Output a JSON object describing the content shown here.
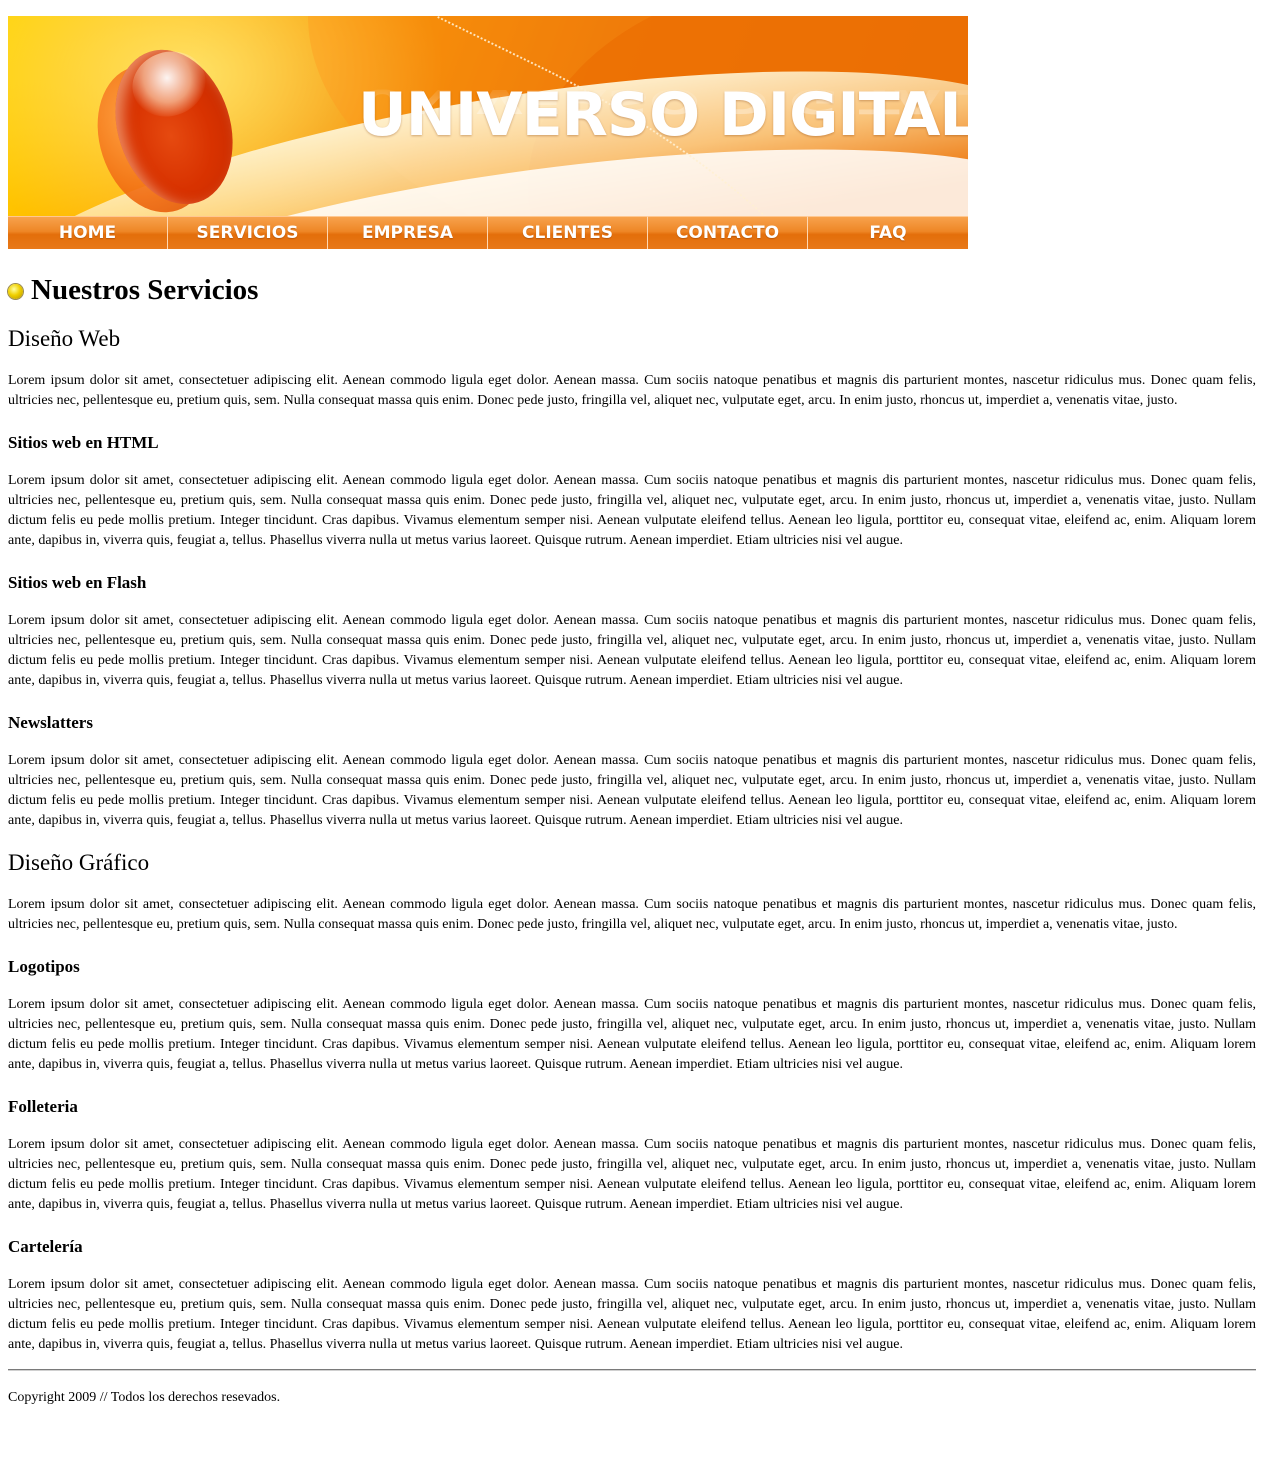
{
  "colors": {
    "accent": "#e8791a",
    "banner_orange": "#e06400",
    "banner_yellow": "#ffd000"
  },
  "banner": {
    "title": "UNIVERSO DIGITAL"
  },
  "nav": {
    "items": [
      "HOME",
      "SERVICIOS",
      "EMPRESA",
      "CLIENTES",
      "CONTACTO",
      "FAQ"
    ]
  },
  "page_title": "Nuestros Servicios",
  "sections": [
    {
      "heading": "Diseño Web",
      "intro": "Lorem ipsum dolor sit amet, consectetuer adipiscing elit. Aenean commodo ligula eget dolor. Aenean massa. Cum sociis natoque penatibus et magnis dis parturient montes, nascetur ridiculus mus. Donec quam felis, ultricies nec, pellentesque eu, pretium quis, sem. Nulla consequat massa quis enim. Donec pede justo, fringilla vel, aliquet nec, vulputate eget, arcu. In enim justo, rhoncus ut, imperdiet a, venenatis vitae, justo.",
      "subsections": [
        {
          "heading": "Sitios web en HTML",
          "text": "Lorem ipsum dolor sit amet, consectetuer adipiscing elit. Aenean commodo ligula eget dolor. Aenean massa. Cum sociis natoque penatibus et magnis dis parturient montes, nascetur ridiculus mus. Donec quam felis, ultricies nec, pellentesque eu, pretium quis, sem. Nulla consequat massa quis enim. Donec pede justo, fringilla vel, aliquet nec, vulputate eget, arcu. In enim justo, rhoncus ut, imperdiet a, venenatis vitae, justo. Nullam dictum felis eu pede mollis pretium. Integer tincidunt. Cras dapibus. Vivamus elementum semper nisi. Aenean vulputate eleifend tellus. Aenean leo ligula, porttitor eu, consequat vitae, eleifend ac, enim. Aliquam lorem ante, dapibus in, viverra quis, feugiat a, tellus. Phasellus viverra nulla ut metus varius laoreet. Quisque rutrum. Aenean imperdiet. Etiam ultricies nisi vel augue."
        },
        {
          "heading": "Sitios web en Flash",
          "text": "Lorem ipsum dolor sit amet, consectetuer adipiscing elit. Aenean commodo ligula eget dolor. Aenean massa. Cum sociis natoque penatibus et magnis dis parturient montes, nascetur ridiculus mus. Donec quam felis, ultricies nec, pellentesque eu, pretium quis, sem. Nulla consequat massa quis enim. Donec pede justo, fringilla vel, aliquet nec, vulputate eget, arcu. In enim justo, rhoncus ut, imperdiet a, venenatis vitae, justo. Nullam dictum felis eu pede mollis pretium. Integer tincidunt. Cras dapibus. Vivamus elementum semper nisi. Aenean vulputate eleifend tellus. Aenean leo ligula, porttitor eu, consequat vitae, eleifend ac, enim. Aliquam lorem ante, dapibus in, viverra quis, feugiat a, tellus. Phasellus viverra nulla ut metus varius laoreet. Quisque rutrum. Aenean imperdiet. Etiam ultricies nisi vel augue."
        },
        {
          "heading": "Newslatters",
          "text": "Lorem ipsum dolor sit amet, consectetuer adipiscing elit. Aenean commodo ligula eget dolor. Aenean massa. Cum sociis natoque penatibus et magnis dis parturient montes, nascetur ridiculus mus. Donec quam felis, ultricies nec, pellentesque eu, pretium quis, sem. Nulla consequat massa quis enim. Donec pede justo, fringilla vel, aliquet nec, vulputate eget, arcu. In enim justo, rhoncus ut, imperdiet a, venenatis vitae, justo. Nullam dictum felis eu pede mollis pretium. Integer tincidunt. Cras dapibus. Vivamus elementum semper nisi. Aenean vulputate eleifend tellus. Aenean leo ligula, porttitor eu, consequat vitae, eleifend ac, enim. Aliquam lorem ante, dapibus in, viverra quis, feugiat a, tellus. Phasellus viverra nulla ut metus varius laoreet. Quisque rutrum. Aenean imperdiet. Etiam ultricies nisi vel augue."
        }
      ]
    },
    {
      "heading": "Diseño Gráfico",
      "intro": "Lorem ipsum dolor sit amet, consectetuer adipiscing elit. Aenean commodo ligula eget dolor. Aenean massa. Cum sociis natoque penatibus et magnis dis parturient montes, nascetur ridiculus mus. Donec quam felis, ultricies nec, pellentesque eu, pretium quis, sem. Nulla consequat massa quis enim. Donec pede justo, fringilla vel, aliquet nec, vulputate eget, arcu. In enim justo, rhoncus ut, imperdiet a, venenatis vitae, justo.",
      "subsections": [
        {
          "heading": "Logotipos",
          "text": "Lorem ipsum dolor sit amet, consectetuer adipiscing elit. Aenean commodo ligula eget dolor. Aenean massa. Cum sociis natoque penatibus et magnis dis parturient montes, nascetur ridiculus mus. Donec quam felis, ultricies nec, pellentesque eu, pretium quis, sem. Nulla consequat massa quis enim. Donec pede justo, fringilla vel, aliquet nec, vulputate eget, arcu. In enim justo, rhoncus ut, imperdiet a, venenatis vitae, justo. Nullam dictum felis eu pede mollis pretium. Integer tincidunt. Cras dapibus. Vivamus elementum semper nisi. Aenean vulputate eleifend tellus. Aenean leo ligula, porttitor eu, consequat vitae, eleifend ac, enim. Aliquam lorem ante, dapibus in, viverra quis, feugiat a, tellus. Phasellus viverra nulla ut metus varius laoreet. Quisque rutrum. Aenean imperdiet. Etiam ultricies nisi vel augue."
        },
        {
          "heading": "Folleteria",
          "text": "Lorem ipsum dolor sit amet, consectetuer adipiscing elit. Aenean commodo ligula eget dolor. Aenean massa. Cum sociis natoque penatibus et magnis dis parturient montes, nascetur ridiculus mus. Donec quam felis, ultricies nec, pellentesque eu, pretium quis, sem. Nulla consequat massa quis enim. Donec pede justo, fringilla vel, aliquet nec, vulputate eget, arcu. In enim justo, rhoncus ut, imperdiet a, venenatis vitae, justo. Nullam dictum felis eu pede mollis pretium. Integer tincidunt. Cras dapibus. Vivamus elementum semper nisi. Aenean vulputate eleifend tellus. Aenean leo ligula, porttitor eu, consequat vitae, eleifend ac, enim. Aliquam lorem ante, dapibus in, viverra quis, feugiat a, tellus. Phasellus viverra nulla ut metus varius laoreet. Quisque rutrum. Aenean imperdiet. Etiam ultricies nisi vel augue."
        },
        {
          "heading": "Cartelería",
          "text": "Lorem ipsum dolor sit amet, consectetuer adipiscing elit. Aenean commodo ligula eget dolor. Aenean massa. Cum sociis natoque penatibus et magnis dis parturient montes, nascetur ridiculus mus. Donec quam felis, ultricies nec, pellentesque eu, pretium quis, sem. Nulla consequat massa quis enim. Donec pede justo, fringilla vel, aliquet nec, vulputate eget, arcu. In enim justo, rhoncus ut, imperdiet a, venenatis vitae, justo. Nullam dictum felis eu pede mollis pretium. Integer tincidunt. Cras dapibus. Vivamus elementum semper nisi. Aenean vulputate eleifend tellus. Aenean leo ligula, porttitor eu, consequat vitae, eleifend ac, enim. Aliquam lorem ante, dapibus in, viverra quis, feugiat a, tellus. Phasellus viverra nulla ut metus varius laoreet. Quisque rutrum. Aenean imperdiet. Etiam ultricies nisi vel augue."
        }
      ]
    }
  ],
  "footer": {
    "copyright": "Copyright 2009 // Todos los derechos resevados."
  }
}
